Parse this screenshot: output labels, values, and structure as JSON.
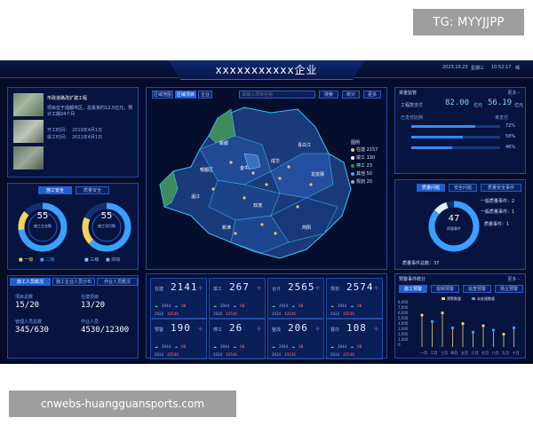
{
  "watermark_top": "TG: MYYJJPP",
  "watermark_bottom": "cnwebs-huangguansports.com",
  "header": {
    "title": "xxxxxxxxxxx企业",
    "date": "2023.10.23",
    "weekday": "星期三",
    "time": "10:52:17",
    "weather": "晴"
  },
  "project": {
    "name": "市政道路改扩建工程",
    "desc": "项目位于成都市区，总投资约12.5亿元，预计工期24个月",
    "start_label": "开工时间：",
    "start_date": "2019年4月1日",
    "end_label": "竣工时间：",
    "end_date": "2021年4月1日"
  },
  "left_tabs": {
    "tab1": "施工安全",
    "tab2": "质量安全"
  },
  "donut1": {
    "value": "55",
    "label": "施工企业数"
  },
  "donut2": {
    "value": "55",
    "label": "施工项目数"
  },
  "legend": {
    "a": "■ 一级",
    "b": "■ 二级",
    "c": "■ 三级",
    "d": "■ 四级"
  },
  "left_bottom_tabs": {
    "tab1": "施工人员概况",
    "tab2": "施工企业人员分布",
    "tab3": "作业人员概况"
  },
  "left_stats": {
    "l1": "项目总数",
    "v1": "15/20",
    "l2": "在建项目",
    "v2": "13/20",
    "l3": "管理人员总数",
    "v3": "345/630",
    "l4": "作业人员",
    "v4": "4530/12300"
  },
  "map": {
    "tab_all": "区域地图",
    "tab_project": "区域项目",
    "tab_ent": "企业",
    "search_placeholder": "请输入项目名称",
    "search_btn": "搜索",
    "btn2": "统计",
    "btn3": "更多",
    "legend_title": "图例",
    "legend": [
      {
        "label": "在建 2157",
        "color": "#e9c46a"
      },
      {
        "label": "竣工 130",
        "color": "#ffffff"
      },
      {
        "label": "停工 23",
        "color": "#2e8b57"
      },
      {
        "label": "其他 50",
        "color": "#4aa3ff"
      },
      {
        "label": "规划 20",
        "color": "#9aa7c8"
      }
    ],
    "districts": [
      "新都",
      "郫都区",
      "金牛",
      "青白江",
      "温江",
      "成华",
      "龙泉驿",
      "双流",
      "新津",
      "简阳"
    ]
  },
  "stats": [
    {
      "label": "在建",
      "value": "2141",
      "unit": "个"
    },
    {
      "label": "竣工",
      "value": "267",
      "unit": "个"
    },
    {
      "label": "合计",
      "value": "2565",
      "unit": "个"
    },
    {
      "label": "规划",
      "value": "2574",
      "unit": "个"
    },
    {
      "label": "预警",
      "value": "190",
      "unit": "个"
    },
    {
      "label": "停工",
      "value": "26",
      "unit": "个"
    },
    {
      "label": "整改",
      "value": "206",
      "unit": "个"
    },
    {
      "label": "督办",
      "value": "108",
      "unit": "个"
    }
  ],
  "stat_rows": {
    "r1a": "2944",
    "r1b": "68",
    "r2a": "2024",
    "r2b": "43546"
  },
  "right_top": {
    "title": "资金监管",
    "more": "更多 ›",
    "l1": "工程款支付",
    "v1": "82.00",
    "u1": "亿元",
    "v2": "56.19",
    "u2": "亿元",
    "r1": "已支付比例",
    "r2": "未支付",
    "p1": "72%",
    "p2": "58%",
    "p3": "46%"
  },
  "right_mid_tabs": {
    "tab1": "质量问题",
    "tab2": "安全问题",
    "tab3": "质量安全事件"
  },
  "events": {
    "l1": "一般质量事件：2",
    "l2": "一般质量事件：1",
    "l3": "质量事件：1",
    "center_value": "47",
    "center_label": "质量事件",
    "bottom": "质量事件总数：37"
  },
  "right_bottom": {
    "title": "预警事件统计",
    "more": "更多 ›",
    "tabs": [
      "施工预警",
      "视频预警",
      "巡查预警",
      "扬尘预警"
    ],
    "yaxis": [
      "8,000",
      "7,000",
      "6,000",
      "5,000",
      "4,000",
      "3,000",
      "2,000",
      "1,000",
      "0"
    ],
    "legend": [
      "预警数量",
      "未处理数量"
    ],
    "categories": [
      "一月",
      "二月",
      "三月",
      "四月",
      "五月",
      "六月",
      "七月",
      "八月",
      "九月",
      "十月"
    ]
  }
}
